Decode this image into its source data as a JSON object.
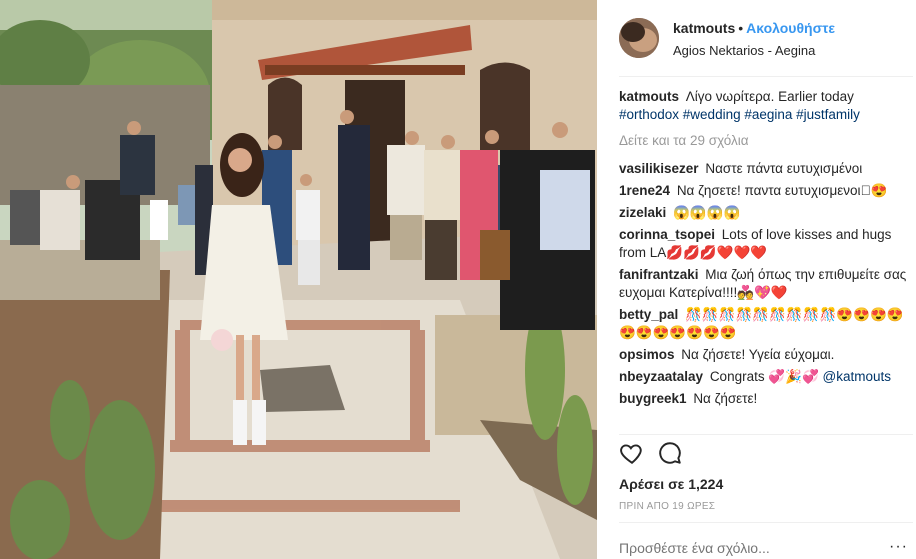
{
  "post": {
    "username": "katmouts",
    "follow_label": "Ακολουθήστε",
    "separator": "•",
    "location": "Agios Nektarios - Aegina",
    "view_all_label": "Δείτε και τα 29 σχόλια",
    "likes_label": "Αρέσει σε 1,224",
    "time_label": "ΠΡΙΝ ΑΠΟ 19 ΩΡΕΣ",
    "add_comment_placeholder": "Προσθέστε ένα σχόλιο...",
    "more_label": "···"
  },
  "caption": {
    "username": "katmouts",
    "text": "Λίγο νωρίτερα. Earlier today",
    "hashtags": "#orthodox #wedding #aegina #justfamily"
  },
  "comments": [
    {
      "user": "vasilikisezer",
      "text": "Ναστε πάντα ευτυχισμένοι"
    },
    {
      "user": "1rene24",
      "text": "Να ζησετε! παντα ευτυχισμενοι🏻😍"
    },
    {
      "user": "zizelaki",
      "text": "😱😱😱😱"
    },
    {
      "user": "corinna_tsopei",
      "text": "Lots of love kisses and hugs from LA💋💋💋❤️❤️❤️"
    },
    {
      "user": "fanifrantzaki",
      "text": "Μια ζωή όπως την επιθυμείτε σας ευχομαι Κατερίνα!!!!💑💖❤️"
    },
    {
      "user": "betty_pal",
      "text": "🎊🎊🎊🎊🎊🎊🎊🎊🎊😍😍😍😍😍😍😍😍😍😍😍"
    },
    {
      "user": "opsimos",
      "text": "Να ζήσετε! Υγεία εύχομαι."
    },
    {
      "user": "nbeyzaatalay",
      "text": "Congrats 💞🎉💞",
      "mention": "@katmouts"
    },
    {
      "user": "buygreek1",
      "text": "Να ζήσετε!"
    }
  ],
  "icons": {
    "heart": "heart-icon",
    "comment": "comment-icon"
  },
  "colors": {
    "link": "#3897f0",
    "hashtag": "#003569",
    "muted": "#999999"
  }
}
